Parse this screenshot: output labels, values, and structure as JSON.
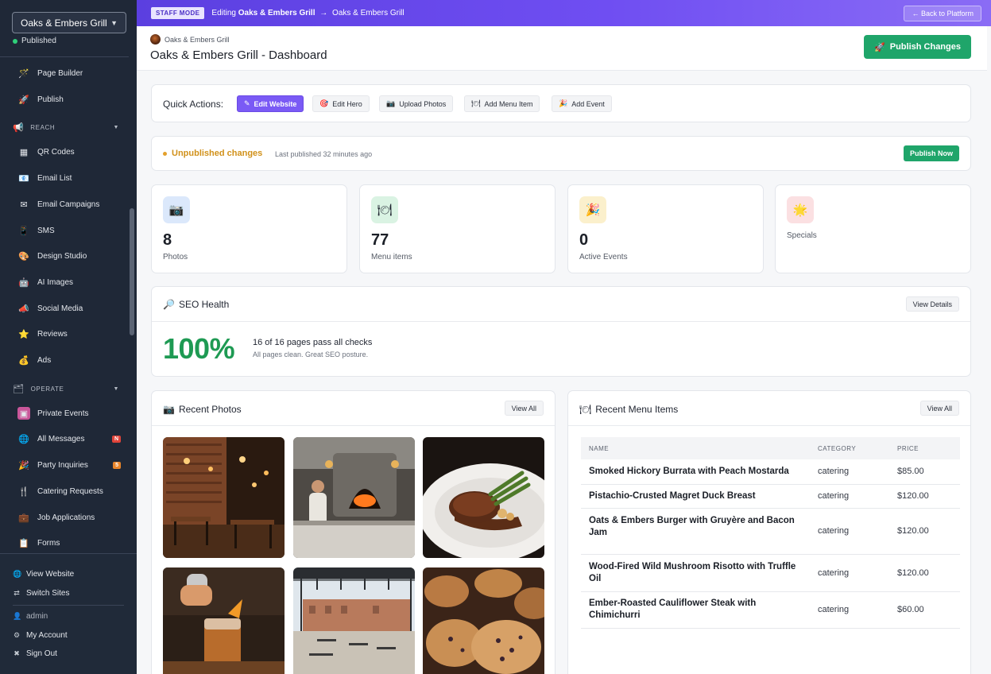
{
  "sidebar": {
    "site_select": "Oaks & Embers Grill",
    "status": "Published",
    "items": [
      {
        "label": "Page Builder",
        "icon": "wand-icon"
      },
      {
        "label": "Publish",
        "icon": "rocket-icon"
      }
    ],
    "reach_section": "REACH",
    "reach_items": [
      {
        "label": "QR Codes",
        "icon": "qr-icon"
      },
      {
        "label": "Email List",
        "icon": "email-icon"
      },
      {
        "label": "Email Campaigns",
        "icon": "envelope-icon"
      },
      {
        "label": "SMS",
        "icon": "phone-icon"
      },
      {
        "label": "Design Studio",
        "icon": "palette-icon"
      },
      {
        "label": "AI Images",
        "icon": "ai-icon"
      },
      {
        "label": "Social Media",
        "icon": "social-icon"
      },
      {
        "label": "Reviews",
        "icon": "star-icon"
      },
      {
        "label": "Ads",
        "icon": "money-bag-icon"
      }
    ],
    "operate_section": "OPERATE",
    "operate_items": [
      {
        "label": "Private Events",
        "icon": "calendar-icon"
      },
      {
        "label": "All Messages",
        "icon": "globe-icon",
        "badge": "N"
      },
      {
        "label": "Party Inquiries",
        "icon": "party-icon",
        "badge": "5"
      },
      {
        "label": "Catering Requests",
        "icon": "fork-icon"
      },
      {
        "label": "Job Applications",
        "icon": "briefcase-icon"
      },
      {
        "label": "Forms",
        "icon": "form-icon"
      }
    ],
    "bottom": {
      "view_website": "View Website",
      "switch_sites": "Switch Sites",
      "user": "admin",
      "my_account": "My Account",
      "sign_out": "Sign Out"
    }
  },
  "banner": {
    "staff_mode": "STAFF MODE",
    "editing_prefix": "Editing",
    "site_name": "Oaks & Embers Grill",
    "arrow": "→",
    "site_name_2": "Oaks & Embers Grill",
    "back_button": "← Back to Platform"
  },
  "header": {
    "crumb": "Oaks & Embers Grill",
    "title": "Oaks & Embers Grill - Dashboard",
    "publish_button": "Publish Changes"
  },
  "quick_actions": {
    "label": "Quick Actions:",
    "buttons": [
      {
        "label": "Edit Website",
        "icon": "pencil-icon"
      },
      {
        "label": "Edit Hero",
        "icon": "target-icon"
      },
      {
        "label": "Upload Photos",
        "icon": "camera-icon"
      },
      {
        "label": "Add Menu Item",
        "icon": "plate-icon"
      },
      {
        "label": "Add Event",
        "icon": "party-icon"
      }
    ]
  },
  "unpublished": {
    "title": "Unpublished changes",
    "subtitle": "Last published 32 minutes ago",
    "button": "Publish Now"
  },
  "stats": [
    {
      "value": "8",
      "label": "Photos",
      "icon": "camera-icon",
      "bg": "#dbe8fb"
    },
    {
      "value": "77",
      "label": "Menu items",
      "icon": "plate-icon",
      "bg": "#daf3e3"
    },
    {
      "value": "0",
      "label": "Active Events",
      "icon": "party-icon",
      "bg": "#fbf0cc"
    },
    {
      "value": "",
      "label": "Specials",
      "icon": "sparkle-icon",
      "bg": "#fbe0e2"
    }
  ],
  "seo": {
    "title": "SEO Health",
    "button": "View Details",
    "percent": "100%",
    "main": "16 of 16 pages pass all checks",
    "sub": "All pages clean. Great SEO posture."
  },
  "recent_photos": {
    "title": "Recent Photos",
    "button": "View All"
  },
  "recent_menu": {
    "title": "Recent Menu Items",
    "button": "View All",
    "columns": [
      "NAME",
      "CATEGORY",
      "PRICE"
    ],
    "rows": [
      {
        "name": "Smoked Hickory Burrata with Peach Mostarda",
        "category": "catering",
        "price": "$85.00"
      },
      {
        "name": "Pistachio-Crusted Magret Duck Breast",
        "category": "catering",
        "price": "$120.00"
      },
      {
        "name": "Oats & Embers Burger with Gruyère and Bacon Jam",
        "category": "catering",
        "price": "$120.00"
      },
      {
        "name": "Wood-Fired Wild Mushroom Risotto with Truffle Oil",
        "category": "catering",
        "price": "$120.00"
      },
      {
        "name": "Ember-Roasted Cauliflower Steak with Chimichurri",
        "category": "catering",
        "price": "$60.00"
      }
    ]
  },
  "colors": {
    "accent": "#7a5af5",
    "success": "#1fa56a",
    "warning": "#d1911a",
    "sidebar_bg": "#1f2837"
  }
}
